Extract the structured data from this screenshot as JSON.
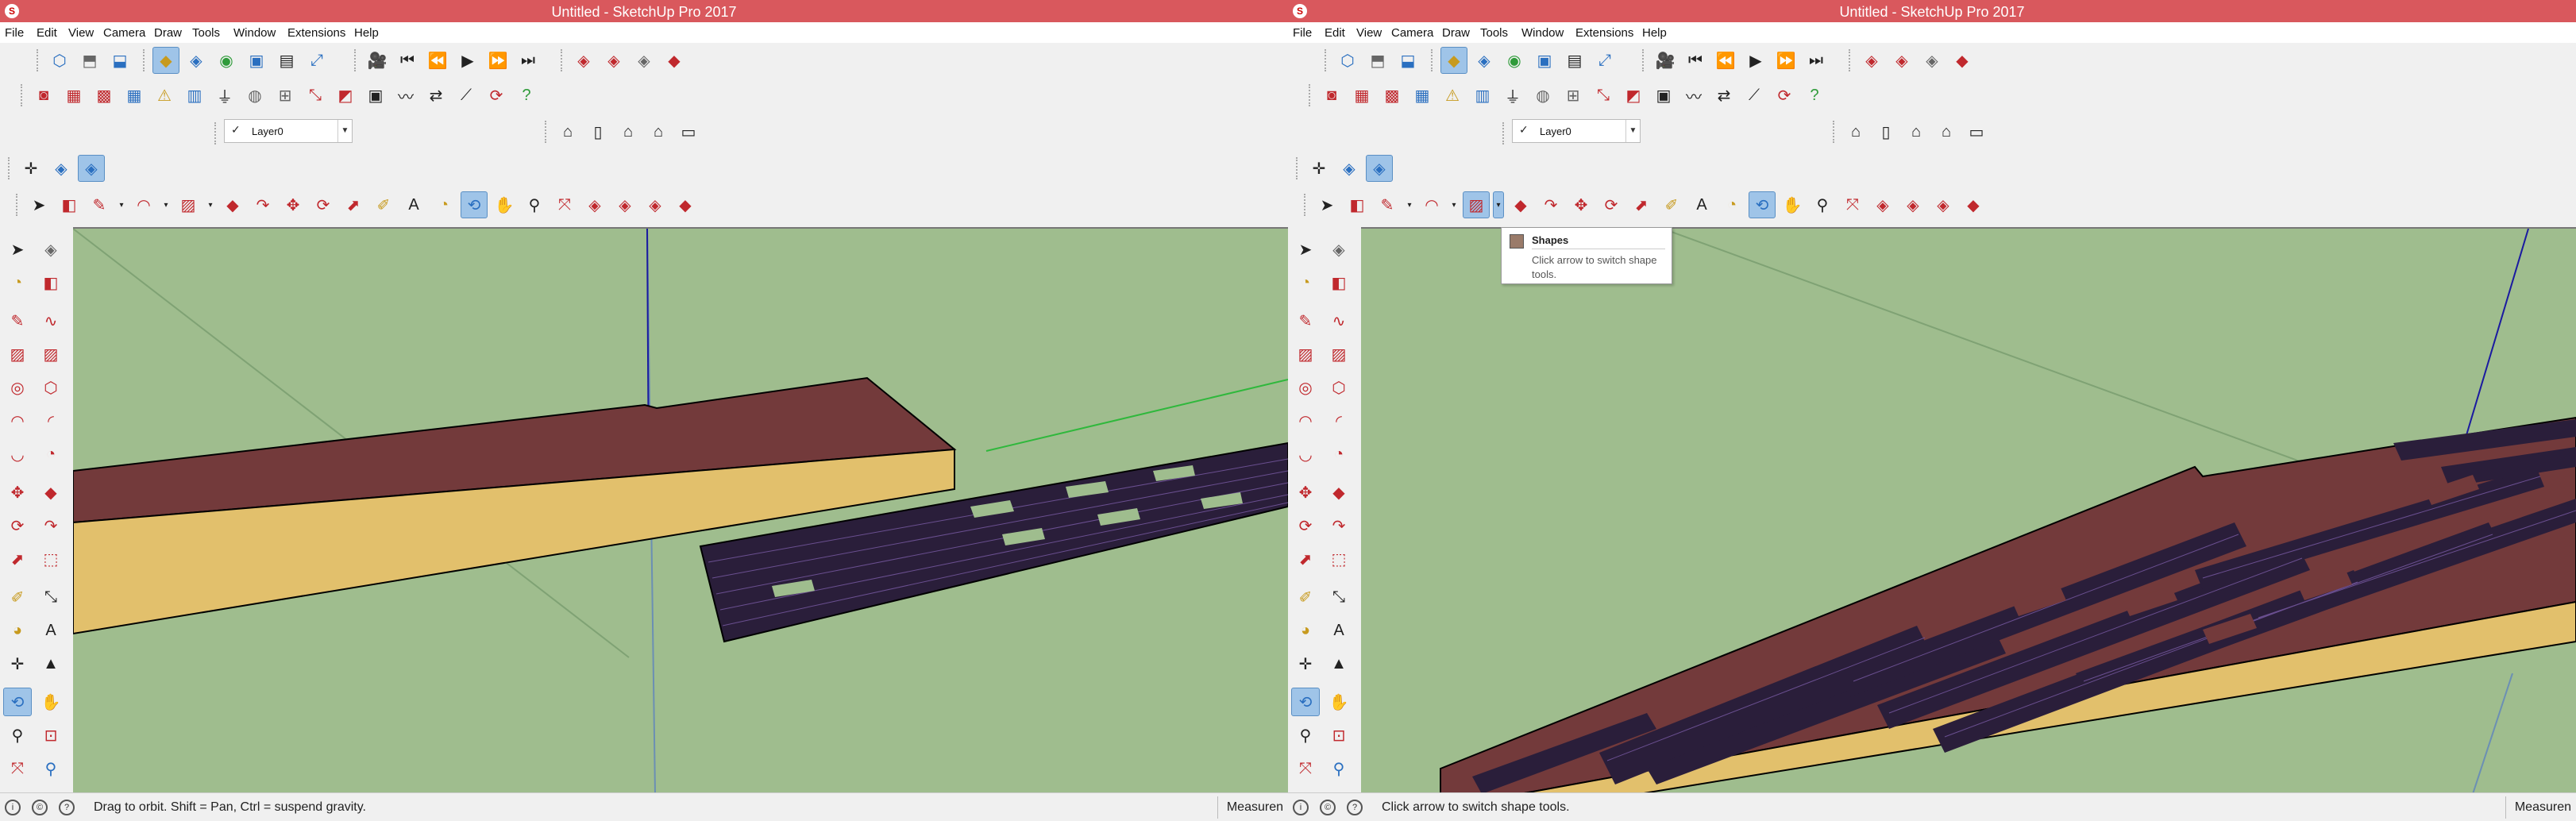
{
  "windows": [
    {
      "title": "Untitled - SketchUp Pro 2017",
      "menu": [
        "File",
        "Edit",
        "View",
        "Camera",
        "Draw",
        "Tools",
        "Window",
        "Extensions",
        "Help"
      ],
      "layer": "Layer0",
      "status_text": "Drag to orbit. Shift = Pan, Ctrl = suspend gravity.",
      "measurements_label": "Measuren"
    },
    {
      "title": "Untitled - SketchUp Pro 2017",
      "menu": [
        "File",
        "Edit",
        "View",
        "Camera",
        "Draw",
        "Tools",
        "Window",
        "Extensions",
        "Help"
      ],
      "layer": "Layer0",
      "status_text": "Click arrow to switch shape tools.",
      "measurements_label": "Measuren"
    }
  ],
  "tooltip": {
    "title": "Shapes",
    "description": "Click arrow to switch shape tools."
  },
  "colors": {
    "title_bar": "#d9585d",
    "viewport_ground": "#9fbd8e",
    "roof_top": "#733a3b",
    "roof_side": "#e2c06c",
    "solar_panels": "#2a1e3a",
    "selection": "#9fc4e8"
  },
  "icons": {
    "toolbar_row1": [
      "iso-view-icon",
      "top-view-icon",
      "front-view-icon",
      "xray-icon",
      "shaded-icon",
      "textured-icon",
      "monochrome-icon",
      "section-plane-icon",
      "display-section-icon",
      "camera-icon",
      "first-scene-icon",
      "previous-scene-icon",
      "play-icon",
      "next-scene-icon",
      "last-scene-icon",
      "warehouse-icon",
      "extension-warehouse-icon",
      "send-to-layout-icon",
      "ruby-icon"
    ],
    "toolbar_row2": [
      "open-icon",
      "save-icon",
      "print-icon",
      "model-info-icon",
      "warning-icon",
      "components-icon",
      "plugin-icon",
      "solid-tools-icon",
      "outliner-icon",
      "grid-icon",
      "scale-icon",
      "protractor-icon",
      "paint-icon",
      "move-icon",
      "rotate-icon",
      "help-icon"
    ],
    "toolbar_row3": [
      "house-wall-icon",
      "house-door-icon",
      "house-icon",
      "house-roof-icon",
      "house-window-icon"
    ],
    "toolbar_row4": [
      "axes-icon",
      "style-icon",
      "style2-icon"
    ],
    "toolbar_row5": [
      "select-icon",
      "eraser-icon",
      "pencil-icon",
      "arc-icon",
      "shapes-icon",
      "push-pull-icon",
      "follow-me-icon",
      "move-icon",
      "rotate-icon",
      "scale-icon",
      "tape-measure-icon",
      "text-icon",
      "paint-bucket-icon",
      "orbit-icon",
      "pan-icon",
      "zoom-icon",
      "zoom-extents-icon",
      "warehouse-icon",
      "ext-warehouse-icon",
      "layout-icon",
      "ruby-icon"
    ]
  }
}
